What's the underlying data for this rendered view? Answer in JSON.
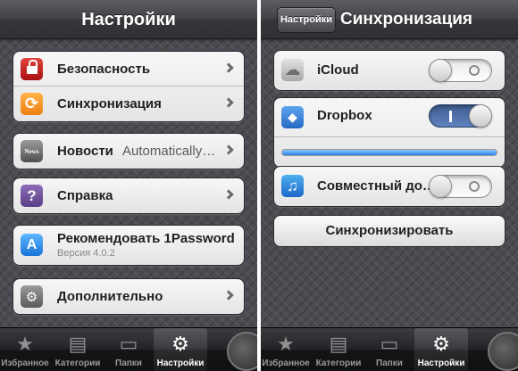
{
  "left": {
    "nav_title": "Настройки",
    "groups": [
      {
        "rows": [
          {
            "label": "Безопасность",
            "icon": "lock-icon"
          },
          {
            "label": "Синхронизация",
            "icon": "sync-icon"
          }
        ]
      },
      {
        "rows": [
          {
            "label": "Новости",
            "value": "Automatically…",
            "icon": "news-icon",
            "icon_text": "News"
          }
        ]
      },
      {
        "rows": [
          {
            "label": "Справка",
            "icon": "help-icon",
            "icon_text": "?"
          }
        ]
      },
      {
        "rows": [
          {
            "label": "Рекомендовать 1Password",
            "sub": "Версия 4.0.2",
            "icon": "appstore-icon",
            "icon_text": "A"
          }
        ]
      },
      {
        "rows": [
          {
            "label": "Дополнительно",
            "icon": "gears-icon",
            "icon_text": "⚙"
          }
        ]
      }
    ]
  },
  "right": {
    "back_label": "Настройки",
    "nav_title": "Синхронизация",
    "icloud": {
      "label": "iCloud",
      "state": "off"
    },
    "dropbox": {
      "label": "Dropbox",
      "state": "on",
      "progress": 1.0
    },
    "shared": {
      "label": "Совместный до…",
      "state": "off"
    },
    "sync_button": "Синхронизировать"
  },
  "tabbar": {
    "tabs": [
      {
        "label": "Избранное",
        "icon": "star-icon",
        "glyph": "★"
      },
      {
        "label": "Категории",
        "icon": "cabinet-icon",
        "glyph": "▤"
      },
      {
        "label": "Папки",
        "icon": "folder-icon",
        "glyph": "▭"
      },
      {
        "label": "Настройки",
        "icon": "gear-icon",
        "glyph": "⚙",
        "active": true
      }
    ]
  },
  "colors": {
    "accent_blue": "#2a81e8",
    "background": "#4a4c51"
  }
}
